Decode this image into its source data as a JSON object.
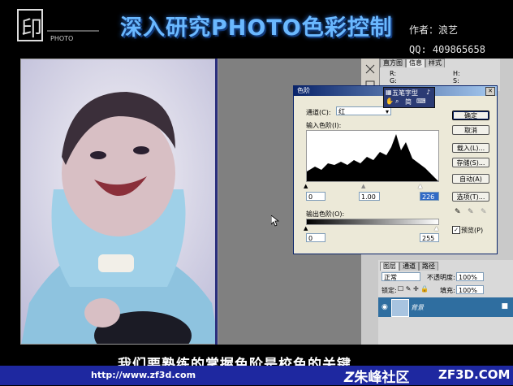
{
  "header": {
    "logo_text": "PHOTO",
    "title": "深入研究PHOTO色彩控制",
    "author": "作者：浪艺",
    "qq": "QQ: 409865658"
  },
  "info_panel": {
    "tabs": [
      "直方图",
      "信息",
      "样式"
    ],
    "r_label": "R:",
    "g_label": "G:",
    "h_label": "H:",
    "s_label": "S:"
  },
  "ime_bar": {
    "label": "五笔字型",
    "sub": "简"
  },
  "levels_dialog": {
    "title": "色阶",
    "channel_label": "通道(C):",
    "channel_value": "红",
    "input_levels_label": "输入色阶(I):",
    "input_black": "0",
    "input_gamma": "1.00",
    "input_white": "226",
    "output_levels_label": "输出色阶(O):",
    "output_black": "0",
    "output_white": "255",
    "buttons": {
      "ok": "确定",
      "cancel": "取消",
      "load": "载入(L)...",
      "save": "存储(S)...",
      "auto": "自动(A)",
      "options": "选项(T)..."
    },
    "preview_label": "预览(P)",
    "preview_checked": true
  },
  "layers_panel": {
    "tabs": [
      "图层",
      "通道",
      "路径"
    ],
    "blend_mode": "正常",
    "opacity_label": "不透明度:",
    "opacity_value": "100%",
    "lock_label": "锁定:",
    "fill_label": "填充:",
    "fill_value": "100%",
    "layer_name": "背景"
  },
  "subtitle": "我们要熟练的掌握色阶是校色的关键",
  "footer": {
    "url": "http://www.zf3d.com",
    "community": "朱峰社区",
    "site": "ZF3D.COM"
  },
  "colors": {
    "title_blue": "#6ab8ff",
    "footer_blue": "#1e28a0",
    "dialog_bg": "#ece9d8",
    "layer_selected": "#2f6ea0"
  }
}
